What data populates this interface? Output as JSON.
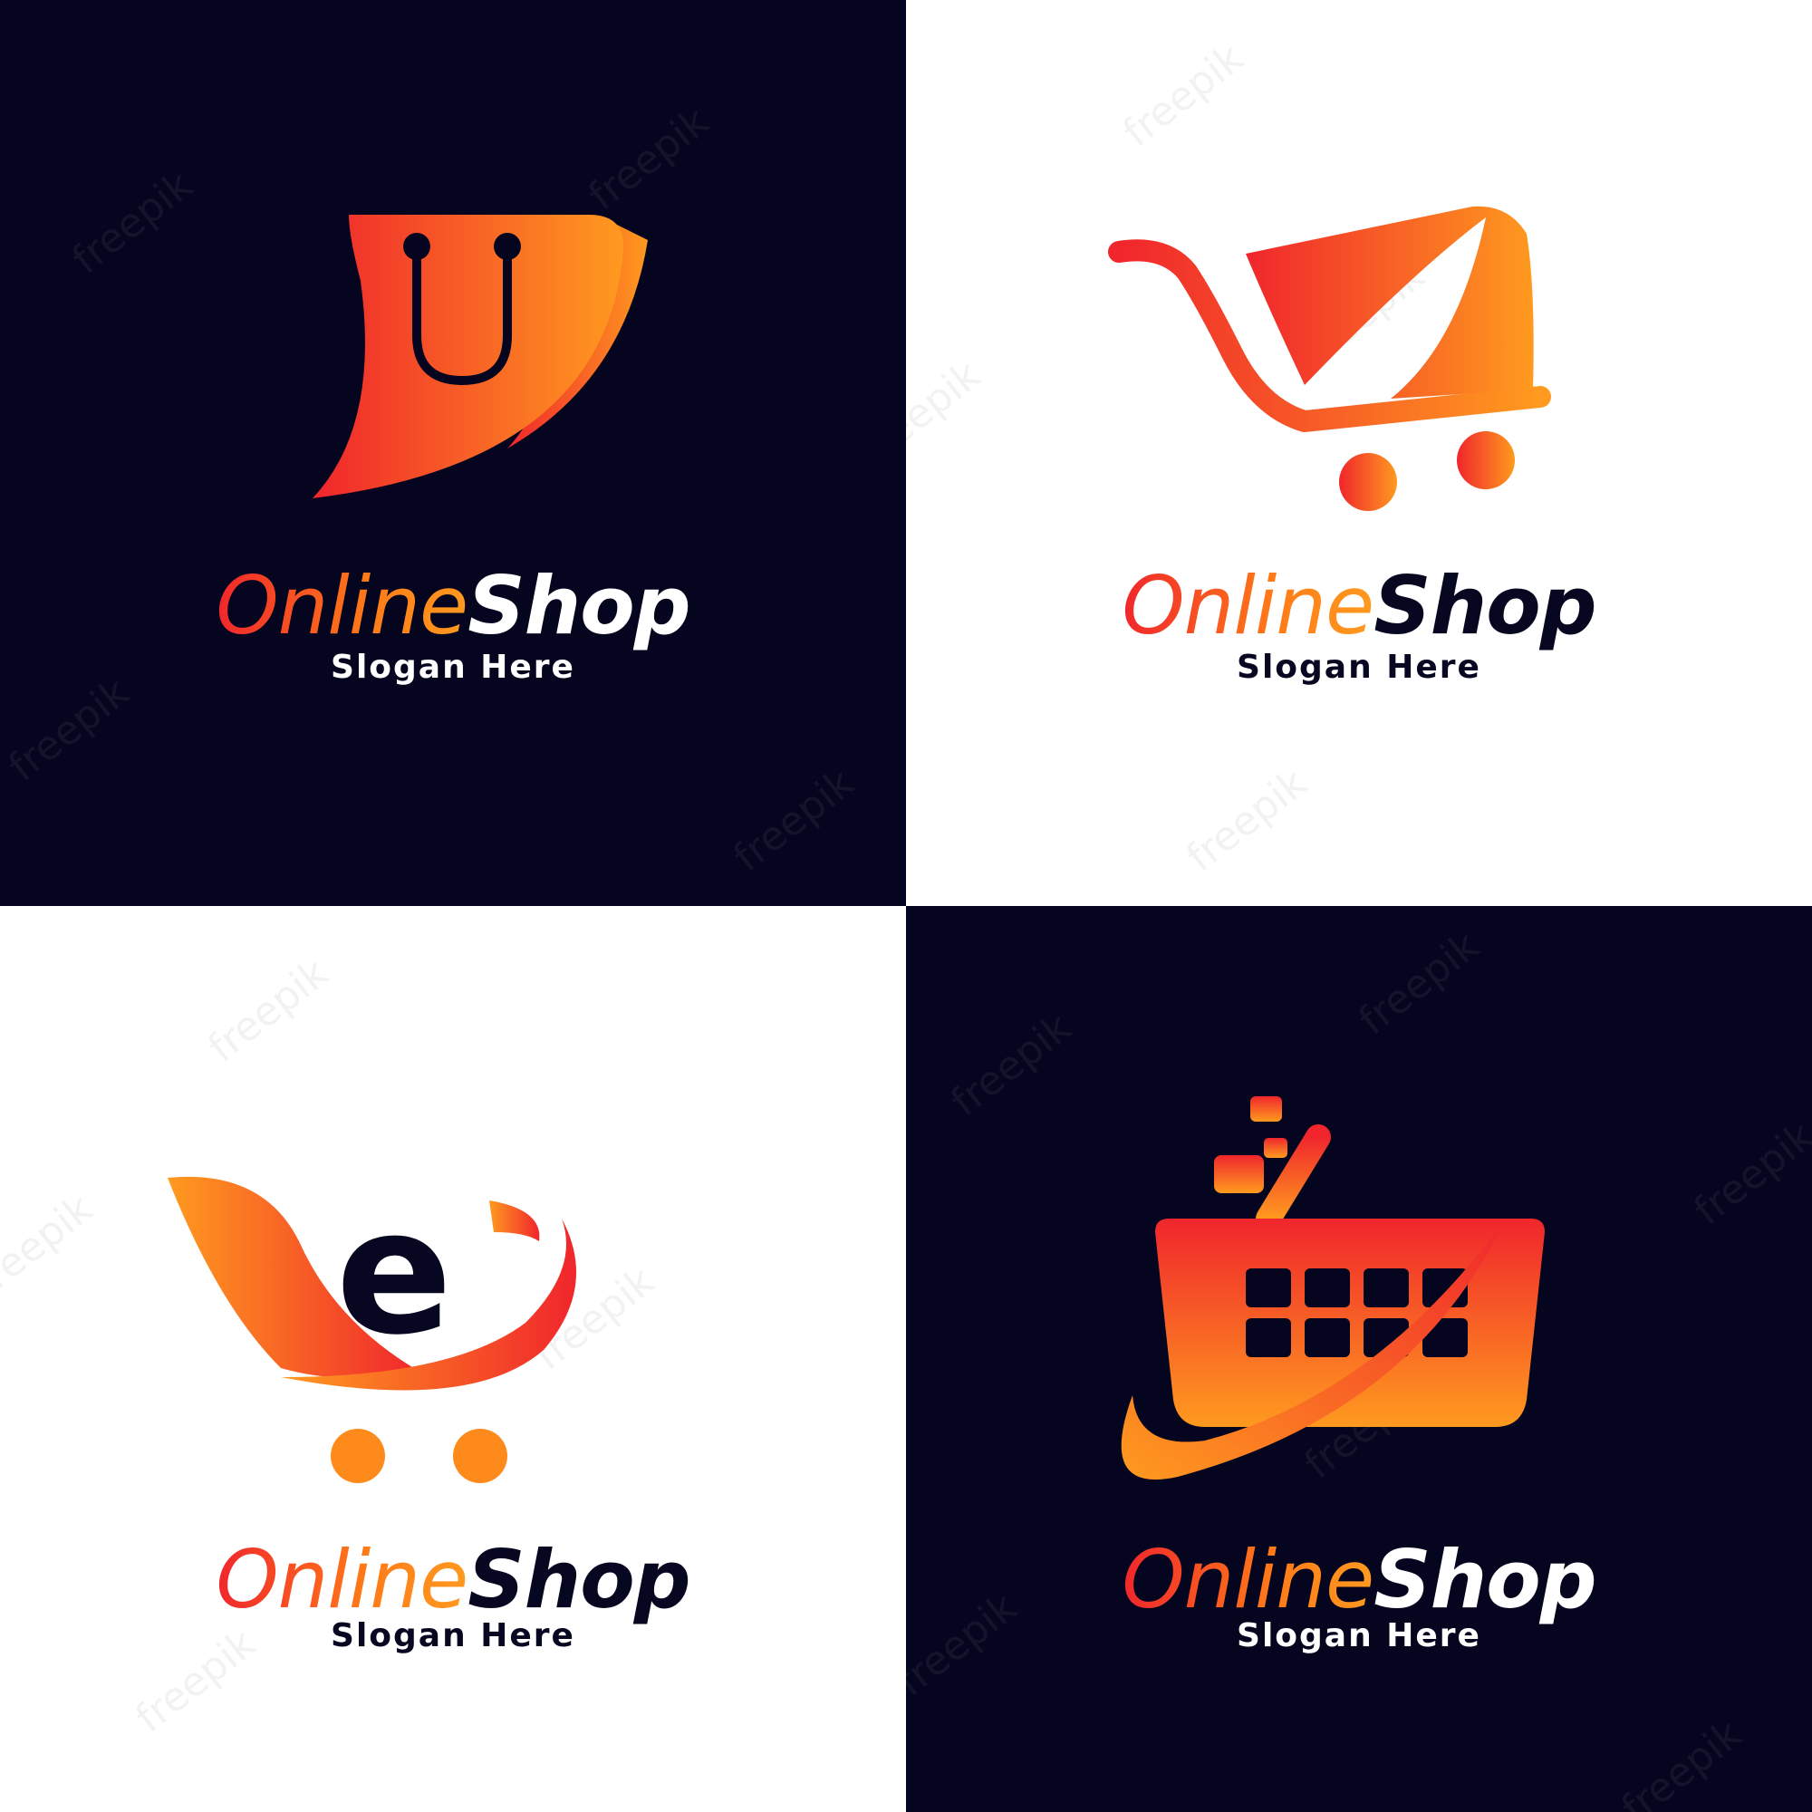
{
  "logos": [
    {
      "brand_part1": "Online",
      "brand_part2": "Shop",
      "slogan": "Slogan Here",
      "icon": "shopping-bag-icon"
    },
    {
      "brand_part1": "Online",
      "brand_part2": "Shop",
      "slogan": "Slogan Here",
      "icon": "shopping-cart-icon"
    },
    {
      "brand_part1": "Online",
      "brand_part2": "Shop",
      "slogan": "Slogan Here",
      "icon": "e-cart-icon"
    },
    {
      "brand_part1": "Online",
      "brand_part2": "Shop",
      "slogan": "Slogan Here",
      "icon": "shopping-basket-icon"
    }
  ],
  "watermark": "freepik",
  "colors": {
    "dark_bg": "#05051f",
    "light_bg": "#ffffff",
    "accent_red": "#f0262c",
    "accent_orange": "#ff8a1c",
    "navy_text": "#070722"
  }
}
